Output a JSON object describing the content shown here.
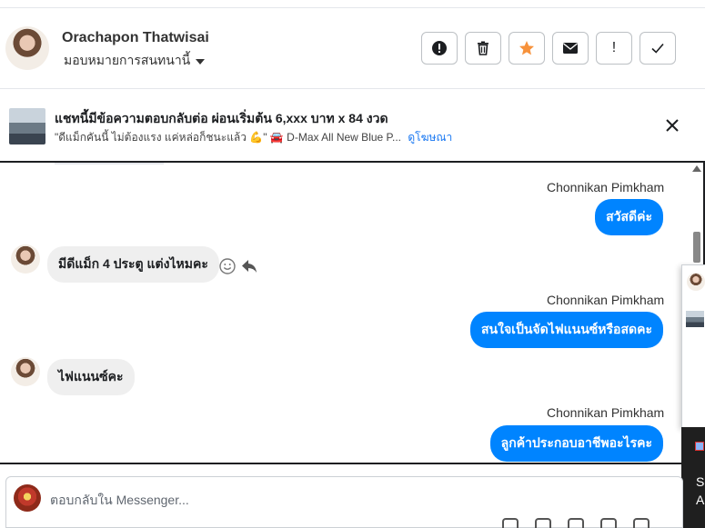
{
  "header": {
    "name": "Orachapon Thatwisai",
    "assign_label": "มอบหมายการสนทนานี้",
    "actions": [
      {
        "icon": "exclamation-circle-icon"
      },
      {
        "icon": "trash-icon"
      },
      {
        "icon": "star-icon",
        "color": "#f7923b"
      },
      {
        "icon": "envelope-icon"
      },
      {
        "icon": "exclamation-icon",
        "text": "!"
      },
      {
        "icon": "checkmark-icon"
      }
    ]
  },
  "ad": {
    "title": "แชทนี้มีข้อความตอบกลับต่อ ผ่อนเริ่มต้น 6,xxx บาท x 84 งวด",
    "subtitle": "\"ดีแม็กคันนี้ ไม่ต้องแรง แค่หล่อก็ชนะแล้ว 💪\" 🚘 D-Max All New Blue P...",
    "link": "ดูโฆษณา"
  },
  "messages": [
    {
      "direction": "out",
      "sender": "Chonnikan Pimkham",
      "text": "สวัสดีค่ะ"
    },
    {
      "direction": "in",
      "text": "มีดีแม็ก 4 ประตู แต่งไหมคะ"
    },
    {
      "direction": "out",
      "sender": "Chonnikan Pimkham",
      "text": "สนใจเป็นจัดไฟแนนซ์หรือสดคะ"
    },
    {
      "direction": "in",
      "text": "ไฟแนนซ์คะ"
    },
    {
      "direction": "out",
      "sender": "Chonnikan Pimkham",
      "text": "ลูกค้าประกอบอาชีพอะไรคะ"
    }
  ],
  "composer": {
    "placeholder": "ตอบกลับใน Messenger..."
  },
  "side_panel": {
    "line1": "S",
    "line2": "A"
  },
  "colors": {
    "accent": "#0084ff",
    "incoming_bubble": "#efefef",
    "star": "#f7923b"
  }
}
